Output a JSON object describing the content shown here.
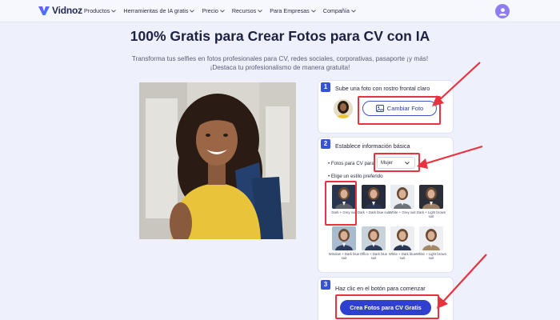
{
  "nav": {
    "logo_text": "Vidnoz",
    "items": [
      {
        "label": "Productos"
      },
      {
        "label": "Herramientas de IA gratis"
      },
      {
        "label": "Precio"
      },
      {
        "label": "Recursos"
      },
      {
        "label": "Para Empresas"
      },
      {
        "label": "Compañía"
      }
    ]
  },
  "hero": {
    "title": "100% Gratis para Crear Fotos para CV con IA",
    "subtitle": "Transforma tus selfies en fotos profesionales para CV, redes sociales, corporativas, pasaporte ¡y más! ¡Destaca tu profesionalismo de manera gratuita!"
  },
  "steps": {
    "step1": {
      "number": "1",
      "title": "Sube una foto con rostro frontal claro",
      "button_label": "Cambiar Foto"
    },
    "step2": {
      "number": "2",
      "title": "Establece información básica",
      "gender_label": "Fotos para CV para",
      "gender_value": "Mujer",
      "style_label": "Elige un estilo preferido",
      "styles": [
        {
          "caption": "Dark + Grey suit",
          "suit": "#5b6068",
          "bg": "#2a3550"
        },
        {
          "caption": "Dark + Dark blue suit",
          "suit": "#2b3552",
          "bg": "#262c3c"
        },
        {
          "caption": "White + Grey suit",
          "suit": "#6d7178",
          "bg": "#e9ecf0"
        },
        {
          "caption": "Dark + Light brown suit",
          "suit": "#9b7f62",
          "bg": "#2c2f38"
        },
        {
          "caption": "Window + Dark blue suit",
          "suit": "#2e3a5e",
          "bg": "#a9bccf"
        },
        {
          "caption": "Office + Dark blue suit",
          "suit": "#2d3a5c",
          "bg": "#c9d3dc"
        },
        {
          "caption": "White + Dark blue suit",
          "suit": "#2c3757",
          "bg": "#eceef2"
        },
        {
          "caption": "White + Light brown suit",
          "suit": "#a58866",
          "bg": "#eceef2"
        }
      ]
    },
    "step3": {
      "number": "3",
      "title": "Haz clic en el botón para comenzar",
      "button_label": "Crea Fotos para CV Gratis"
    }
  },
  "colors": {
    "accent": "#2f3fd0",
    "annotation": "#e8323f",
    "background": "#eef0fb"
  }
}
